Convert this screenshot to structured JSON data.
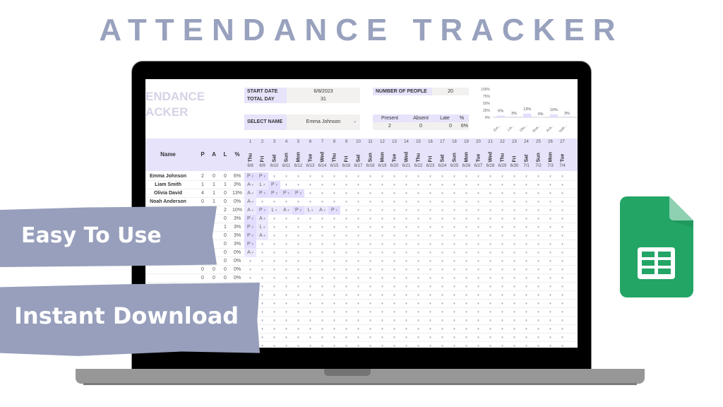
{
  "hero": {
    "title": "ATTENDANCE TRACKER"
  },
  "sheet": {
    "brand_line1": "ENDANCE",
    "brand_line2": "ACKER",
    "start_date_label": "START DATE",
    "start_date_value": "6/8/2023",
    "total_day_label": "TOTAL DAY",
    "total_day_value": "31",
    "people_label": "NUMBER OF PEOPLE",
    "people_value": "20",
    "select_name_label": "SELECT NAME",
    "select_name_value": "Emma Johnson",
    "summary_headers": [
      "Present",
      "Absent",
      "Late",
      "%"
    ],
    "summary_values": [
      "2",
      "0",
      "0",
      "6%"
    ],
    "grid_headers": {
      "name": "Name",
      "p": "P",
      "a": "A",
      "l": "L",
      "pct": "%"
    },
    "days": [
      {
        "n": "1",
        "w": "Thu",
        "d": "6/8"
      },
      {
        "n": "2",
        "w": "Fri",
        "d": "6/9"
      },
      {
        "n": "3",
        "w": "Sat",
        "d": "6/10"
      },
      {
        "n": "4",
        "w": "Sun",
        "d": "6/11"
      },
      {
        "n": "5",
        "w": "Mon",
        "d": "6/12"
      },
      {
        "n": "6",
        "w": "Tue",
        "d": "6/13"
      },
      {
        "n": "7",
        "w": "Wed",
        "d": "6/14"
      },
      {
        "n": "8",
        "w": "Thu",
        "d": "6/15"
      },
      {
        "n": "9",
        "w": "Fri",
        "d": "6/16"
      },
      {
        "n": "10",
        "w": "Sat",
        "d": "6/17"
      },
      {
        "n": "11",
        "w": "Sun",
        "d": "6/18"
      },
      {
        "n": "12",
        "w": "Mon",
        "d": "6/19"
      },
      {
        "n": "13",
        "w": "Tue",
        "d": "6/20"
      },
      {
        "n": "14",
        "w": "Wed",
        "d": "6/21"
      },
      {
        "n": "15",
        "w": "Thu",
        "d": "6/22"
      },
      {
        "n": "16",
        "w": "Fri",
        "d": "6/23"
      },
      {
        "n": "17",
        "w": "Sat",
        "d": "6/24"
      },
      {
        "n": "18",
        "w": "Sun",
        "d": "6/25"
      },
      {
        "n": "19",
        "w": "Mon",
        "d": "6/26"
      },
      {
        "n": "20",
        "w": "Tue",
        "d": "6/27"
      },
      {
        "n": "21",
        "w": "Wed",
        "d": "6/28"
      },
      {
        "n": "22",
        "w": "Thu",
        "d": "6/29"
      },
      {
        "n": "23",
        "w": "Fri",
        "d": "6/30"
      },
      {
        "n": "24",
        "w": "Sat",
        "d": "7/1"
      },
      {
        "n": "25",
        "w": "Sun",
        "d": "7/2"
      },
      {
        "n": "26",
        "w": "Mon",
        "d": "7/3"
      },
      {
        "n": "27",
        "w": "Tue",
        "d": "7/4"
      }
    ],
    "rows": [
      {
        "name": "Emma Johnson",
        "p": "2",
        "a": "0",
        "l": "0",
        "pct": "6%",
        "marks": [
          "P",
          "P"
        ]
      },
      {
        "name": "Liam Smith",
        "p": "1",
        "a": "1",
        "l": "1",
        "pct": "3%",
        "marks": [
          "A",
          "L",
          "P"
        ]
      },
      {
        "name": "Olivia David",
        "p": "4",
        "a": "1",
        "l": "0",
        "pct": "13%",
        "marks": [
          "A",
          "P",
          "P",
          "P",
          "P"
        ]
      },
      {
        "name": "Noah Anderson",
        "p": "0",
        "a": "1",
        "l": "0",
        "pct": "0%",
        "marks": [
          "A"
        ]
      },
      {
        "name": "",
        "p": "",
        "a": "",
        "l": "2",
        "pct": "10%",
        "marks": [
          "A",
          "P",
          "L",
          "A",
          "P",
          "L",
          "A",
          "P"
        ]
      },
      {
        "name": "",
        "p": "",
        "a": "",
        "l": "0",
        "pct": "3%",
        "marks": [
          "P",
          "A"
        ]
      },
      {
        "name": "",
        "p": "",
        "a": "",
        "l": "1",
        "pct": "3%",
        "marks": [
          "P",
          "L"
        ]
      },
      {
        "name": "",
        "p": "",
        "a": "",
        "l": "0",
        "pct": "3%",
        "marks": [
          "P",
          "A"
        ]
      },
      {
        "name": "",
        "p": "",
        "a": "",
        "l": "0",
        "pct": "3%",
        "marks": [
          "P"
        ]
      },
      {
        "name": "",
        "p": "",
        "a": "",
        "l": "0",
        "pct": "0%",
        "marks": [
          "A"
        ]
      },
      {
        "name": "",
        "p": "",
        "a": "",
        "l": "0",
        "pct": "0%",
        "marks": []
      },
      {
        "name": "",
        "p": "0",
        "a": "0",
        "l": "0",
        "pct": "0%",
        "marks": []
      },
      {
        "name": "",
        "p": "0",
        "a": "0",
        "l": "0",
        "pct": "0%",
        "marks": []
      },
      {
        "name": "",
        "p": "",
        "a": "",
        "l": "",
        "pct": "",
        "marks": []
      },
      {
        "name": "",
        "p": "",
        "a": "",
        "l": "",
        "pct": "",
        "marks": []
      },
      {
        "name": "",
        "p": "",
        "a": "",
        "l": "",
        "pct": "",
        "marks": []
      },
      {
        "name": "",
        "p": "",
        "a": "",
        "l": "",
        "pct": "",
        "marks": []
      },
      {
        "name": "",
        "p": "",
        "a": "",
        "l": "",
        "pct": "",
        "marks": []
      },
      {
        "name": "",
        "p": "",
        "a": "",
        "l": "",
        "pct": "",
        "marks": []
      },
      {
        "name": "",
        "p": "",
        "a": "",
        "l": "",
        "pct": "",
        "marks": []
      },
      {
        "name": "",
        "p": "",
        "a": "",
        "l": "",
        "pct": "",
        "marks": []
      }
    ],
    "dropdown_glyph": "▾"
  },
  "chart_data": {
    "type": "bar",
    "categories": [
      "Em...",
      "Lia...",
      "Oliv...",
      "Noa...",
      "Ava...",
      "Isab..."
    ],
    "values": [
      6,
      3,
      13,
      0,
      10,
      3
    ],
    "labels": [
      "6%",
      "3%",
      "13%",
      "0%",
      "10%",
      "3%"
    ],
    "y_ticks": [
      "0%",
      "25%",
      "50%",
      "75%",
      "100%"
    ],
    "ylim": [
      0,
      100
    ],
    "bar_color": "#e3defe"
  },
  "banners": {
    "easy": "Easy To Use",
    "download": "Instant Download"
  },
  "colors": {
    "accent": "#979fbc",
    "header_bg": "#e6e3fb",
    "sheets_green": "#23a566"
  }
}
